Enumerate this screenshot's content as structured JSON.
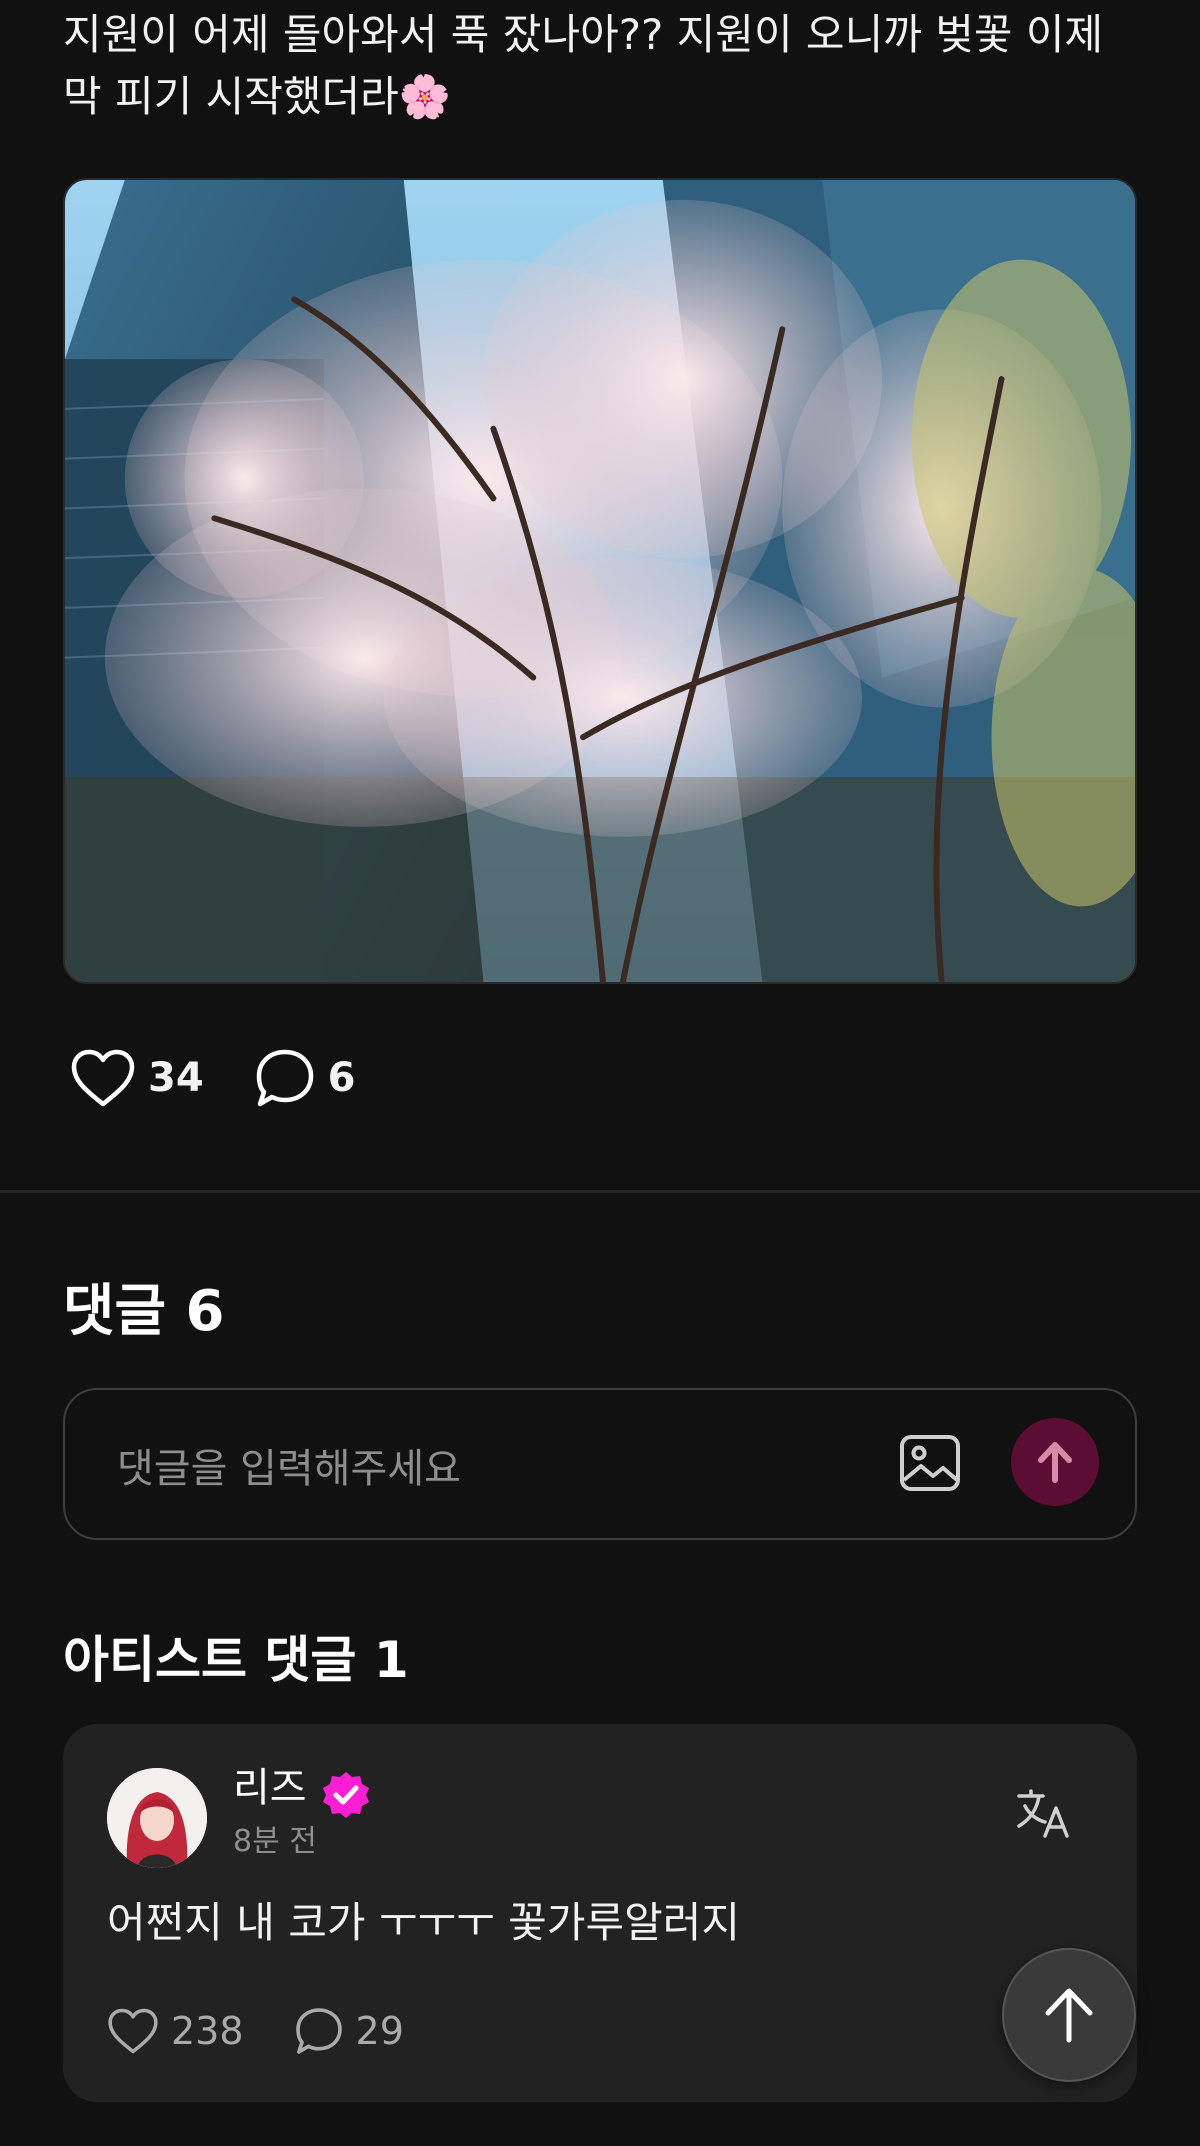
{
  "post": {
    "text": "지원이 어제 돌아와서 푹 잤나아?? 지원이 오니까 벚꽃 이제 막 피기 시작했더라🌸",
    "image_icon": "cherry-blossom-photo",
    "likes": "34",
    "comments": "6"
  },
  "comments_section": {
    "title": "댓글 6",
    "input_placeholder": "댓글을 입력해주세요",
    "send_color": "#5c0d33"
  },
  "artist_comments": {
    "title": "아티스트 댓글 1",
    "items": [
      {
        "name": "리즈",
        "time": "8분 전",
        "text": "어쩐지 내 코가 ㅜㅜㅜ 꽃가루알러지",
        "likes": "238",
        "replies": "29",
        "verified_color": "#ff1fd2"
      }
    ]
  },
  "colors": {
    "background": "#111111",
    "card": "#222222",
    "accent": "#ff1fd2"
  }
}
